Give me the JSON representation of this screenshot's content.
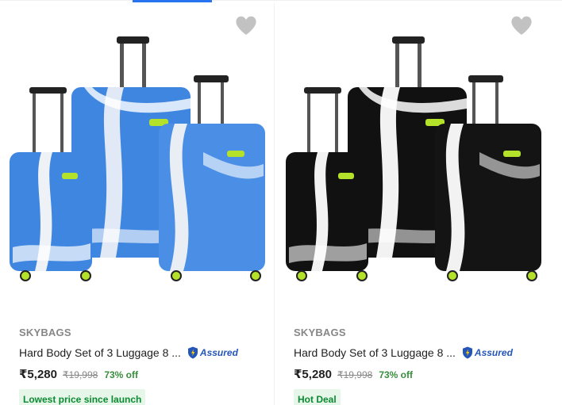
{
  "products": [
    {
      "brand": "SKYBAGS",
      "title": "Hard Body Set of 3 Luggage 8 ...",
      "assured_label": "Assured",
      "price": "₹5,280",
      "mrp": "₹19,998",
      "discount": "73% off",
      "badge": "Lowest price since launch",
      "color_variant": "blue",
      "icons": {
        "wishlist": "heart-icon",
        "assured": "shield-icon"
      }
    },
    {
      "brand": "SKYBAGS",
      "title": "Hard Body Set of 3 Luggage 8 ...",
      "assured_label": "Assured",
      "price": "₹5,280",
      "mrp": "₹19,998",
      "discount": "73% off",
      "badge": "Hot Deal",
      "color_variant": "black",
      "icons": {
        "wishlist": "heart-icon",
        "assured": "shield-icon"
      }
    }
  ],
  "colors": {
    "accent": "#2874f0",
    "discount_green": "#388e3c",
    "badge_bg": "#e6f6e9",
    "badge_text": "#0c8a32",
    "assured_blue": "#2455b8",
    "wishlist_grey": "#c2c2c2",
    "blue_luggage": "#3f86e0",
    "black_luggage": "#111111",
    "wheel_lime": "#b4e12a"
  }
}
